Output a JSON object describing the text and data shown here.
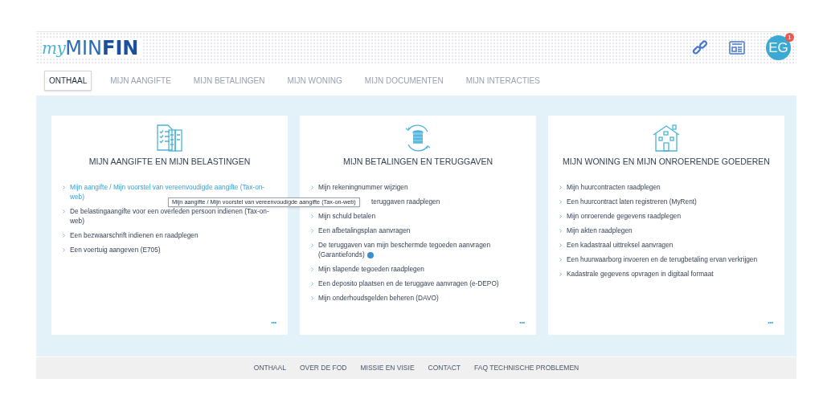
{
  "logo": {
    "prefix": "my",
    "light": "MIN",
    "bold": "FIN"
  },
  "header": {
    "avatar": "EG",
    "badge": "1"
  },
  "tabs": [
    {
      "label": "ONTHAAL",
      "selected": true
    },
    {
      "label": "MIJN AANGIFTE",
      "selected": false
    },
    {
      "label": "MIJN BETALINGEN",
      "selected": false
    },
    {
      "label": "MIJN WONING",
      "selected": false
    },
    {
      "label": "MIJN DOCUMENTEN",
      "selected": false
    },
    {
      "label": "MIJN INTERACTIES",
      "selected": false
    }
  ],
  "cards": [
    {
      "title": "MIJN AANGIFTE EN MIJN BELASTINGEN",
      "more": "•••",
      "items": [
        {
          "kind": "link",
          "text": "Mijn aangifte / Mijn voorstel van vereenvoudigde aangifte (Tax-on-web)"
        },
        {
          "kind": "item",
          "text": "De belastingaangifte voor een overleden persoon indienen (Tax-on-web)"
        },
        {
          "kind": "item",
          "text": "Een bezwaarschrift indienen en raadplegen"
        },
        {
          "kind": "item",
          "text": "Een voertuig aangeven (E705)"
        }
      ]
    },
    {
      "title": "MIJN BETALINGEN EN TERUGGAVEN",
      "more": "•••",
      "items": [
        {
          "kind": "item",
          "text": "Mijn rekeningnummer wijzigen"
        },
        {
          "kind": "covered",
          "text": "teruggaven raadplegen"
        },
        {
          "kind": "item",
          "text": "Mijn schuld betalen"
        },
        {
          "kind": "item",
          "text": "Een afbetalingsplan aanvragen"
        },
        {
          "kind": "help",
          "text": "De teruggaven van mijn beschermde tegoeden aanvragen (Garantiefonds)"
        },
        {
          "kind": "item",
          "text": "Mijn slapende tegoeden raadplegen"
        },
        {
          "kind": "item",
          "text": "Een deposito plaatsen en de teruggave aanvragen (e-DEPO)"
        },
        {
          "kind": "item",
          "text": "Mijn onderhoudsgelden beheren (DAVO)"
        }
      ]
    },
    {
      "title": "MIJN WONING EN MIJN ONROERENDE GOEDEREN",
      "more": "•••",
      "items": [
        {
          "kind": "item",
          "text": "Mijn huurcontracten raadplegen"
        },
        {
          "kind": "item",
          "text": "Een huurcontract laten registreren (MyRent)"
        },
        {
          "kind": "item",
          "text": "Mijn onroerende gegevens raadplegen"
        },
        {
          "kind": "item",
          "text": "Mijn akten raadplegen"
        },
        {
          "kind": "item",
          "text": "Een kadastraal uittreksel aanvragen"
        },
        {
          "kind": "item",
          "text": "Een huurwaarborg invoeren en de terugbetaling ervan verkrijgen"
        },
        {
          "kind": "item",
          "text": "Kadastrale gegevens opvragen in digitaal formaat"
        }
      ]
    }
  ],
  "tooltip": "Mijn aangifte / Mijn voorstel van vereenvoudigde aangifte (Tax-on-web)",
  "footer": [
    "ONTHAAL",
    "OVER DE FOD",
    "MISSIE EN VISIE",
    "CONTACT",
    "FAQ TECHNISCHE PROBLEMEN"
  ]
}
